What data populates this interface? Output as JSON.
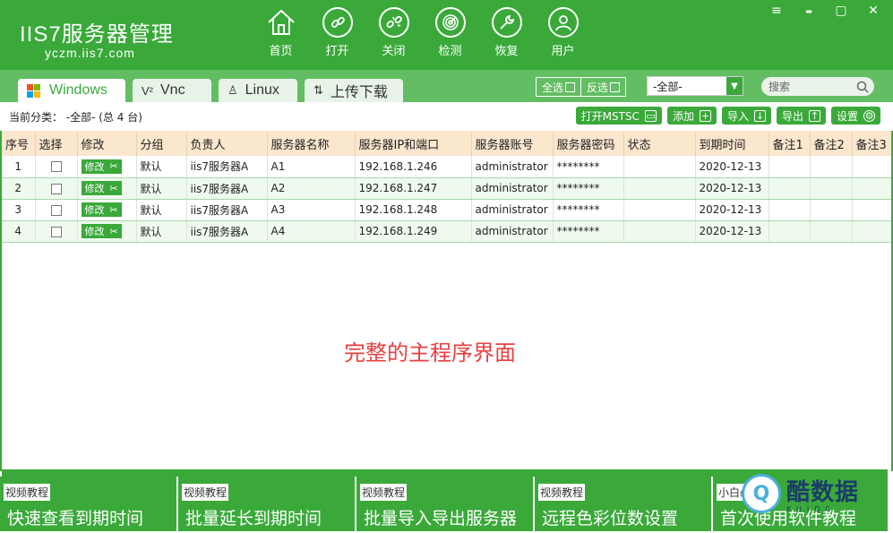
{
  "app": {
    "logo_main": "IIS7服务器管理",
    "logo_sub": "yczm.iis7.com"
  },
  "toolbar": [
    {
      "label": "首页",
      "icon": "home-icon"
    },
    {
      "label": "打开",
      "icon": "link-icon"
    },
    {
      "label": "关闭",
      "icon": "unlink-icon"
    },
    {
      "label": "检测",
      "icon": "radar-icon"
    },
    {
      "label": "恢复",
      "icon": "wrench-icon"
    },
    {
      "label": "用户",
      "icon": "user-icon"
    }
  ],
  "window_controls": {
    "menu": "≡",
    "minimize": "▬",
    "maximize": "▢",
    "close": "✕"
  },
  "tabs": [
    {
      "label": "Windows",
      "active": true
    },
    {
      "label": "Vnc",
      "active": false
    },
    {
      "label": "Linux",
      "active": false
    },
    {
      "label": "上传下载",
      "active": false
    }
  ],
  "select_buttons": {
    "select_all": "全选",
    "invert": "反选"
  },
  "category_select": {
    "value": "-全部-"
  },
  "search": {
    "placeholder": "搜索"
  },
  "info": {
    "current_category": "当前分类： -全部- (总 4 台)"
  },
  "actions": {
    "open_mstsc": "打开MSTSC",
    "add": "添加",
    "import": "导入",
    "export": "导出",
    "settings": "设置"
  },
  "table": {
    "headers": [
      "序号",
      "选择",
      "修改",
      "分组",
      "负责人",
      "服务器名称",
      "服务器IP和端口",
      "服务器账号",
      "服务器密码",
      "状态",
      "到期时间",
      "备注1",
      "备注2",
      "备注3"
    ],
    "edit_label": "修改",
    "rows": [
      {
        "no": "1",
        "group": "默认",
        "owner": "iis7服务器A",
        "name": "A1",
        "ip": "192.168.1.246",
        "account": "administrator",
        "password": "********",
        "status": "",
        "expiry": "2020-12-13"
      },
      {
        "no": "2",
        "group": "默认",
        "owner": "iis7服务器A",
        "name": "A2",
        "ip": "192.168.1.247",
        "account": "administrator",
        "password": "********",
        "status": "",
        "expiry": "2020-12-13"
      },
      {
        "no": "3",
        "group": "默认",
        "owner": "iis7服务器A",
        "name": "A3",
        "ip": "192.168.1.248",
        "account": "administrator",
        "password": "********",
        "status": "",
        "expiry": "2020-12-13"
      },
      {
        "no": "4",
        "group": "默认",
        "owner": "iis7服务器A",
        "name": "A4",
        "ip": "192.168.1.249",
        "account": "administrator",
        "password": "********",
        "status": "",
        "expiry": "2020-12-13"
      }
    ]
  },
  "caption": "完整的主程序界面",
  "video_cards": [
    {
      "tag": "视频教程",
      "title": "快速查看到期时间"
    },
    {
      "tag": "视频教程",
      "title": "批量延长到期时间"
    },
    {
      "tag": "视频教程",
      "title": "批量导入导出服务器"
    },
    {
      "tag": "视频教程",
      "title": "远程色彩位数设置"
    },
    {
      "tag": "小白必看",
      "title": "首次使用软件教程"
    }
  ],
  "watermark": {
    "cn": "酷数据",
    "en": "KUIDC"
  },
  "colors": {
    "brand_green": "#3aa93a",
    "header_row": "#fbe6ce",
    "caption_red": "#e84040"
  }
}
